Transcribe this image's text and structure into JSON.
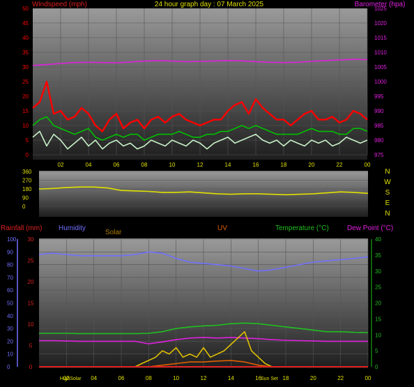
{
  "title": "24 hour graph day : 07 March 2025",
  "colors": {
    "background": "#000000",
    "wind_gust": "#ff0000",
    "wind_avg": "#00c000",
    "wind_speed": "#c8f0c8",
    "barometer": "#e020e0",
    "direction": "#e0e000",
    "humidity": "#7070ff",
    "temperature": "#20c020",
    "dewpoint": "#e020e0",
    "solar": "#e0c000",
    "uv": "#e06000",
    "rain_axis": "#e02020",
    "time_axis": "#e0e000"
  },
  "chart_data": [
    {
      "id": "wind_baro",
      "type": "line",
      "left_axis_label": "Windspeed (mph)",
      "right_axis_label": "Barometer (hpa)",
      "x_ticks": [
        "02",
        "04",
        "06",
        "08",
        "10",
        "12",
        "14",
        "16",
        "18",
        "20",
        "22",
        "00"
      ],
      "x_range_hours": [
        0,
        24
      ],
      "left_ylim": [
        0,
        50
      ],
      "left_ticks": [
        0,
        5,
        10,
        15,
        20,
        25,
        30,
        35,
        40,
        45,
        50
      ],
      "right_ylim": [
        975,
        1025
      ],
      "right_ticks": [
        975,
        980,
        985,
        990,
        995,
        1000,
        1005,
        1010,
        1015,
        1020,
        1025
      ],
      "series": [
        {
          "key": "wind_gust",
          "axis": "left",
          "x": [
            0,
            0.5,
            1,
            1.5,
            2,
            2.5,
            3,
            3.5,
            4,
            4.5,
            5,
            5.5,
            6,
            6.5,
            7,
            7.5,
            8,
            8.5,
            9,
            9.5,
            10,
            10.5,
            11,
            11.5,
            12,
            12.5,
            13,
            13.5,
            14,
            14.5,
            15,
            15.5,
            16,
            16.5,
            17,
            17.5,
            18,
            18.5,
            19,
            19.5,
            20,
            20.5,
            21,
            21.5,
            22,
            22.5,
            23,
            23.5,
            24
          ],
          "values": [
            16,
            18,
            25,
            14,
            15,
            12,
            13,
            16,
            14,
            10,
            8,
            12,
            14,
            9,
            11,
            12,
            9,
            12,
            13,
            11,
            13,
            14,
            12,
            11,
            10,
            11,
            12,
            12,
            15,
            17,
            18,
            14,
            19,
            16,
            14,
            12,
            12,
            10,
            12,
            14,
            15,
            12,
            12,
            13,
            11,
            12,
            15,
            14,
            12
          ]
        },
        {
          "key": "wind_avg",
          "axis": "left",
          "x": [
            0,
            0.5,
            1,
            1.5,
            2,
            2.5,
            3,
            3.5,
            4,
            4.5,
            5,
            5.5,
            6,
            6.5,
            7,
            7.5,
            8,
            8.5,
            9,
            9.5,
            10,
            10.5,
            11,
            11.5,
            12,
            12.5,
            13,
            13.5,
            14,
            14.5,
            15,
            15.5,
            16,
            16.5,
            17,
            17.5,
            18,
            18.5,
            19,
            19.5,
            20,
            20.5,
            21,
            21.5,
            22,
            22.5,
            23,
            23.5,
            24
          ],
          "values": [
            10,
            12,
            13,
            10,
            9,
            8,
            7,
            8,
            9,
            6,
            5,
            6,
            7,
            6,
            7,
            7,
            5,
            6,
            7,
            7,
            7,
            8,
            7,
            6,
            6,
            7,
            7,
            8,
            8,
            9,
            10,
            9,
            10,
            9,
            8,
            7,
            7,
            7,
            7,
            8,
            9,
            8,
            8,
            8,
            7,
            7,
            9,
            9,
            8
          ]
        },
        {
          "key": "wind_speed",
          "axis": "left",
          "x": [
            0,
            0.5,
            1,
            1.5,
            2,
            2.5,
            3,
            3.5,
            4,
            4.5,
            5,
            5.5,
            6,
            6.5,
            7,
            7.5,
            8,
            8.5,
            9,
            9.5,
            10,
            10.5,
            11,
            11.5,
            12,
            12.5,
            13,
            13.5,
            14,
            14.5,
            15,
            15.5,
            16,
            16.5,
            17,
            17.5,
            18,
            18.5,
            19,
            19.5,
            20,
            20.5,
            21,
            21.5,
            22,
            22.5,
            23,
            23.5,
            24
          ],
          "values": [
            6,
            8,
            3,
            7,
            5,
            2,
            4,
            6,
            3,
            5,
            2,
            4,
            5,
            3,
            4,
            2,
            3,
            5,
            4,
            3,
            5,
            4,
            3,
            5,
            4,
            2,
            4,
            5,
            6,
            4,
            5,
            6,
            7,
            5,
            4,
            5,
            3,
            5,
            4,
            3,
            5,
            4,
            5,
            3,
            4,
            6,
            5,
            4,
            5
          ]
        },
        {
          "key": "barometer",
          "axis": "right",
          "x": [
            0,
            1,
            2,
            3,
            4,
            5,
            6,
            7,
            8,
            9,
            10,
            11,
            12,
            13,
            14,
            15,
            16,
            17,
            18,
            19,
            20,
            21,
            22,
            23,
            24
          ],
          "values": [
            1005.5,
            1005.8,
            1006.2,
            1006.5,
            1006.6,
            1006.5,
            1006.4,
            1006.7,
            1007.0,
            1007.2,
            1007.0,
            1006.8,
            1006.9,
            1007.0,
            1007.2,
            1007.1,
            1006.8,
            1006.6,
            1006.5,
            1006.6,
            1006.9,
            1007.2,
            1007.4,
            1007.6,
            1007.5
          ]
        }
      ]
    },
    {
      "id": "direction",
      "type": "line",
      "x_range_hours": [
        0,
        24
      ],
      "ylim": [
        0,
        360
      ],
      "y_ticks": [
        0,
        90,
        180,
        270,
        360
      ],
      "compass_labels": [
        "N",
        "W",
        "S",
        "E",
        "N"
      ],
      "series": [
        {
          "key": "direction",
          "x": [
            0,
            1,
            2,
            3,
            4,
            5,
            6,
            7,
            8,
            9,
            10,
            11,
            12,
            13,
            14,
            15,
            16,
            17,
            18,
            19,
            20,
            21,
            22,
            23,
            24
          ],
          "values": [
            180,
            185,
            195,
            200,
            200,
            190,
            165,
            160,
            155,
            145,
            145,
            150,
            140,
            130,
            125,
            130,
            130,
            125,
            120,
            125,
            130,
            140,
            150,
            145,
            135
          ]
        }
      ]
    },
    {
      "id": "temp_humidity",
      "type": "line",
      "labels": {
        "rainfall": "Rainfall (mm)",
        "humidity": "Humidity",
        "solar": "Solar",
        "uv": "UV",
        "temperature": "Temperature (°C)",
        "dewpoint": "Dew Point (°C)"
      },
      "x_range_hours": [
        0,
        24
      ],
      "x_ticks": [
        "02",
        "04",
        "06",
        "08",
        "10",
        "12",
        "14",
        "16",
        "18",
        "20",
        "22",
        "00"
      ],
      "event_labels": [
        {
          "text": "HighSolar",
          "hour": 2.3
        },
        {
          "text": "Sun Set",
          "hour": 16.8
        }
      ],
      "humidity_ylim": [
        0,
        100
      ],
      "humidity_ticks": [
        0,
        10,
        20,
        30,
        40,
        50,
        60,
        70,
        80,
        90,
        100
      ],
      "rain_ylim": [
        0,
        30
      ],
      "rain_ticks": [
        0,
        5,
        10,
        15,
        20,
        25,
        30
      ],
      "temp_ylim": [
        0,
        40
      ],
      "temp_ticks": [
        0,
        5,
        10,
        15,
        20,
        25,
        30,
        35,
        40
      ],
      "series": [
        {
          "key": "humidity",
          "axis": "humidity",
          "x": [
            0,
            1,
            2,
            3,
            4,
            5,
            6,
            7,
            8,
            9,
            10,
            11,
            12,
            13,
            14,
            15,
            16,
            17,
            18,
            19,
            20,
            21,
            22,
            23,
            24
          ],
          "values": [
            88,
            89,
            88,
            87,
            87,
            87,
            87,
            88,
            90,
            89,
            85,
            82,
            81,
            80,
            79,
            77,
            75,
            76,
            78,
            80,
            82,
            83,
            84,
            85,
            86
          ]
        },
        {
          "key": "temperature",
          "axis": "temp",
          "x": [
            0,
            1,
            2,
            3,
            4,
            5,
            6,
            7,
            8,
            9,
            10,
            11,
            12,
            13,
            14,
            15,
            16,
            17,
            18,
            19,
            20,
            21,
            22,
            23,
            24
          ],
          "values": [
            10.5,
            10.5,
            10.5,
            10.4,
            10.4,
            10.4,
            10.4,
            10.4,
            10.5,
            11.0,
            12.0,
            12.5,
            12.8,
            13.0,
            13.5,
            13.7,
            13.5,
            13.0,
            12.5,
            12.0,
            11.5,
            11.0,
            11.0,
            10.8,
            10.7
          ]
        },
        {
          "key": "dewpoint",
          "axis": "temp",
          "x": [
            0,
            1,
            2,
            3,
            4,
            5,
            6,
            7,
            8,
            9,
            10,
            11,
            12,
            13,
            14,
            15,
            16,
            17,
            18,
            19,
            20,
            21,
            22,
            23,
            24
          ],
          "values": [
            8.2,
            8.2,
            8.1,
            8.0,
            8.0,
            8.0,
            8.0,
            8.0,
            7.2,
            7.8,
            8.5,
            9.0,
            9.2,
            9.0,
            9.2,
            9.0,
            8.8,
            8.5,
            8.3,
            8.2,
            8.1,
            8.0,
            8.0,
            8.0,
            8.0
          ]
        },
        {
          "key": "solar",
          "axis": "temp",
          "x": [
            0,
            7,
            7.5,
            8,
            8.5,
            9,
            9.5,
            10,
            10.5,
            11,
            11.5,
            12,
            12.5,
            13,
            13.5,
            14,
            14.5,
            15,
            15.5,
            16,
            16.5,
            17,
            24
          ],
          "values": [
            0,
            0,
            1,
            2,
            3,
            5,
            4,
            6,
            3,
            4,
            3,
            6,
            3,
            4,
            5,
            7,
            9,
            11,
            5,
            3,
            1,
            0,
            0
          ]
        },
        {
          "key": "uv",
          "axis": "temp",
          "x": [
            0,
            8,
            9,
            10,
            11,
            12,
            13,
            14,
            15,
            16,
            17,
            24
          ],
          "values": [
            0,
            0,
            0.5,
            1,
            1.5,
            1.5,
            1.8,
            2,
            1.5,
            0.5,
            0,
            0
          ]
        },
        {
          "key": "rain",
          "axis": "rain",
          "x": [
            0,
            24
          ],
          "values": [
            0,
            0
          ]
        }
      ]
    }
  ]
}
